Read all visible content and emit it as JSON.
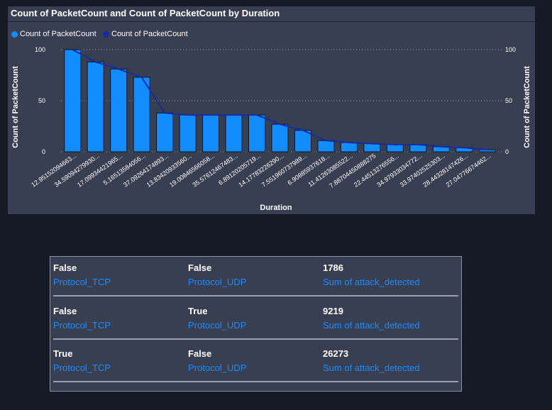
{
  "chart_data": {
    "type": "bar+line",
    "title": "Count of PacketCount and Count of PacketCount by Duration",
    "xlabel": "Duration",
    "ylabel_left": "Count of PacketCount",
    "ylabel_right": "Count of PacketCount",
    "ylim": [
      0,
      100
    ],
    "yticks": [
      0,
      50,
      100
    ],
    "grid": true,
    "legend_position": "top-left",
    "categories": [
      "12.95152094663...",
      "34.59094279930...",
      "17.09934421965...",
      "5.16513584056...",
      "37.09264174893...",
      "13.83420933560...",
      "19.00846566058...",
      "35.57612467483...",
      "6.89120205719...",
      "14.17783226290...",
      "7.551960737989...",
      "6.90885937618...",
      "11.41263085522...",
      "7.88704450888275",
      "22.44513276556...",
      "34.97933034772...",
      "33.97402525303...",
      "28.44328147426...",
      "27.04776674462..."
    ],
    "series": [
      {
        "name": "Count of PacketCount",
        "kind": "bar",
        "color": "#118dff",
        "values": [
          100,
          88,
          81,
          73,
          38,
          36,
          36,
          36,
          36,
          27,
          21,
          11,
          9,
          8,
          7,
          7,
          5,
          4,
          2
        ]
      },
      {
        "name": "Count of PacketCount",
        "kind": "line",
        "color": "#1b2aa0",
        "values": [
          100,
          88,
          81,
          73,
          38,
          36,
          36,
          36,
          36,
          27,
          21,
          11,
          9,
          8,
          7,
          7,
          5,
          4,
          2
        ]
      }
    ]
  },
  "cards": [
    {
      "tcp_value": "False",
      "tcp_label": "Protocol_TCP",
      "udp_value": "False",
      "udp_label": "Protocol_UDP",
      "sum_value": "1786",
      "sum_label": "Sum of attack_detected"
    },
    {
      "tcp_value": "False",
      "tcp_label": "Protocol_TCP",
      "udp_value": "True",
      "udp_label": "Protocol_UDP",
      "sum_value": "9219",
      "sum_label": "Sum of attack_detected"
    },
    {
      "tcp_value": "True",
      "tcp_label": "Protocol_TCP",
      "udp_value": "False",
      "udp_label": "Protocol_UDP",
      "sum_value": "26273",
      "sum_label": "Sum of attack_detected"
    }
  ]
}
